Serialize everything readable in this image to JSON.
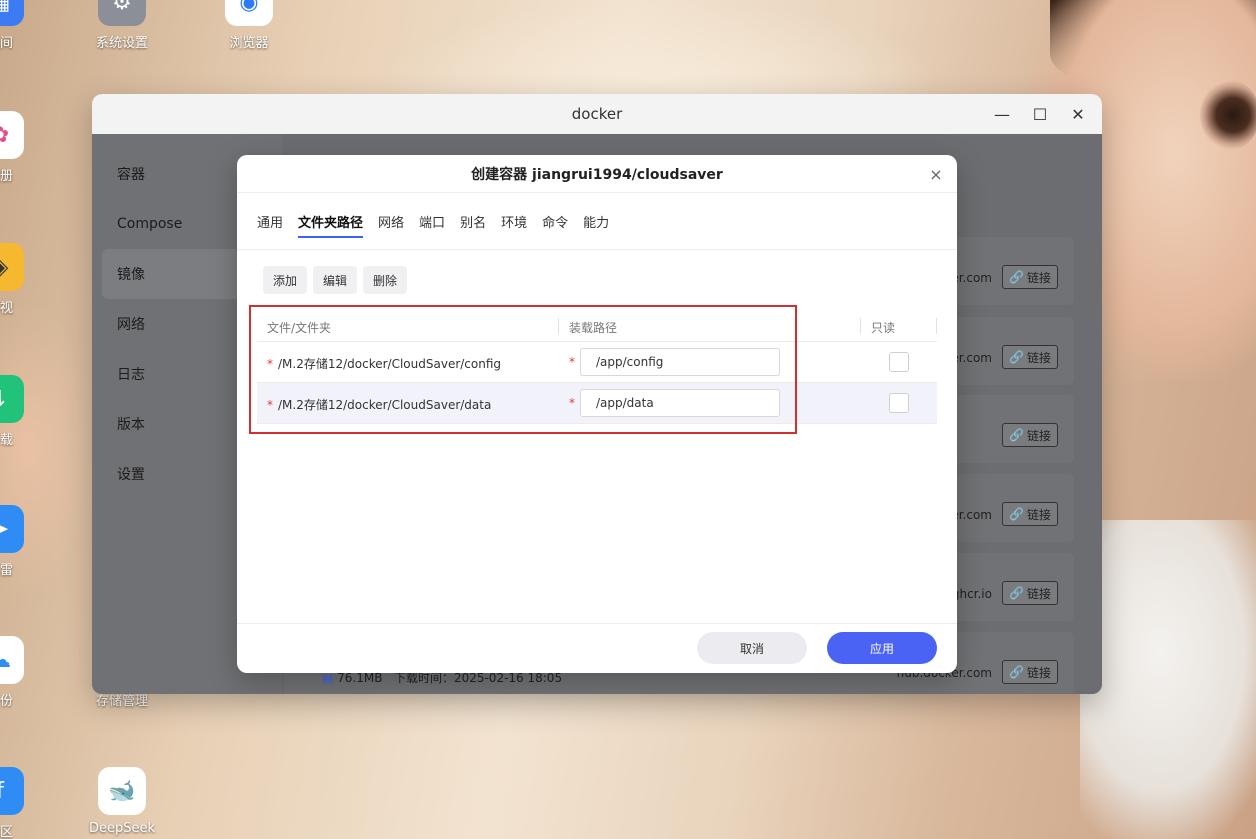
{
  "desktop": {
    "icons": [
      {
        "label": "空间"
      },
      {
        "label": "系统设置"
      },
      {
        "label": "浏览器"
      },
      {
        "label": "相册"
      },
      {
        "label": "影视"
      },
      {
        "label": "下载"
      },
      {
        "label": "迅雷"
      },
      {
        "label": "备份"
      },
      {
        "label": "存储管理"
      },
      {
        "label": "社区"
      },
      {
        "label": "DeepSeek"
      }
    ]
  },
  "window": {
    "title": "docker",
    "minimize": "—",
    "maximize": "☐",
    "close": "✕"
  },
  "sidebar": {
    "items": [
      {
        "label": "容器"
      },
      {
        "label": "Compose"
      },
      {
        "label": "镜像"
      },
      {
        "label": "网络"
      },
      {
        "label": "日志"
      },
      {
        "label": "版本"
      },
      {
        "label": "设置"
      }
    ]
  },
  "background_list": {
    "rows": [
      {
        "domain": "hub.docker.com",
        "link": "链接"
      },
      {
        "domain": "hub.docker.com",
        "link": "链接"
      },
      {
        "domain": "",
        "link": "链接"
      },
      {
        "domain": "hub.docker.com",
        "link": "链接"
      },
      {
        "domain": "ghcr.io",
        "link": "链接"
      },
      {
        "domain": "hub.docker.com",
        "link": "链接"
      }
    ],
    "bottom_size": "76.1MB",
    "bottom_time": "下载时间：2025-02-16 18:05"
  },
  "modal": {
    "title": "创建容器 jiangrui1994/cloudsaver",
    "close": "×",
    "tabs": [
      {
        "label": "通用"
      },
      {
        "label": "文件夹路径"
      },
      {
        "label": "网络"
      },
      {
        "label": "端口"
      },
      {
        "label": "别名"
      },
      {
        "label": "环境"
      },
      {
        "label": "命令"
      },
      {
        "label": "能力"
      }
    ],
    "toolbar": {
      "add": "添加",
      "edit": "编辑",
      "delete": "删除"
    },
    "table": {
      "headers": {
        "path": "文件/文件夹",
        "mount": "装载路径",
        "readonly": "只读"
      },
      "rows": [
        {
          "path": "/M.2存储12/docker/CloudSaver/config",
          "mount": "/app/config"
        },
        {
          "path": "/M.2存储12/docker/CloudSaver/data",
          "mount": "/app/data"
        }
      ]
    },
    "footer": {
      "cancel": "取消",
      "apply": "应用"
    }
  },
  "colors": {
    "accent": "#4a63f5",
    "highlight": "#d32f2f"
  }
}
